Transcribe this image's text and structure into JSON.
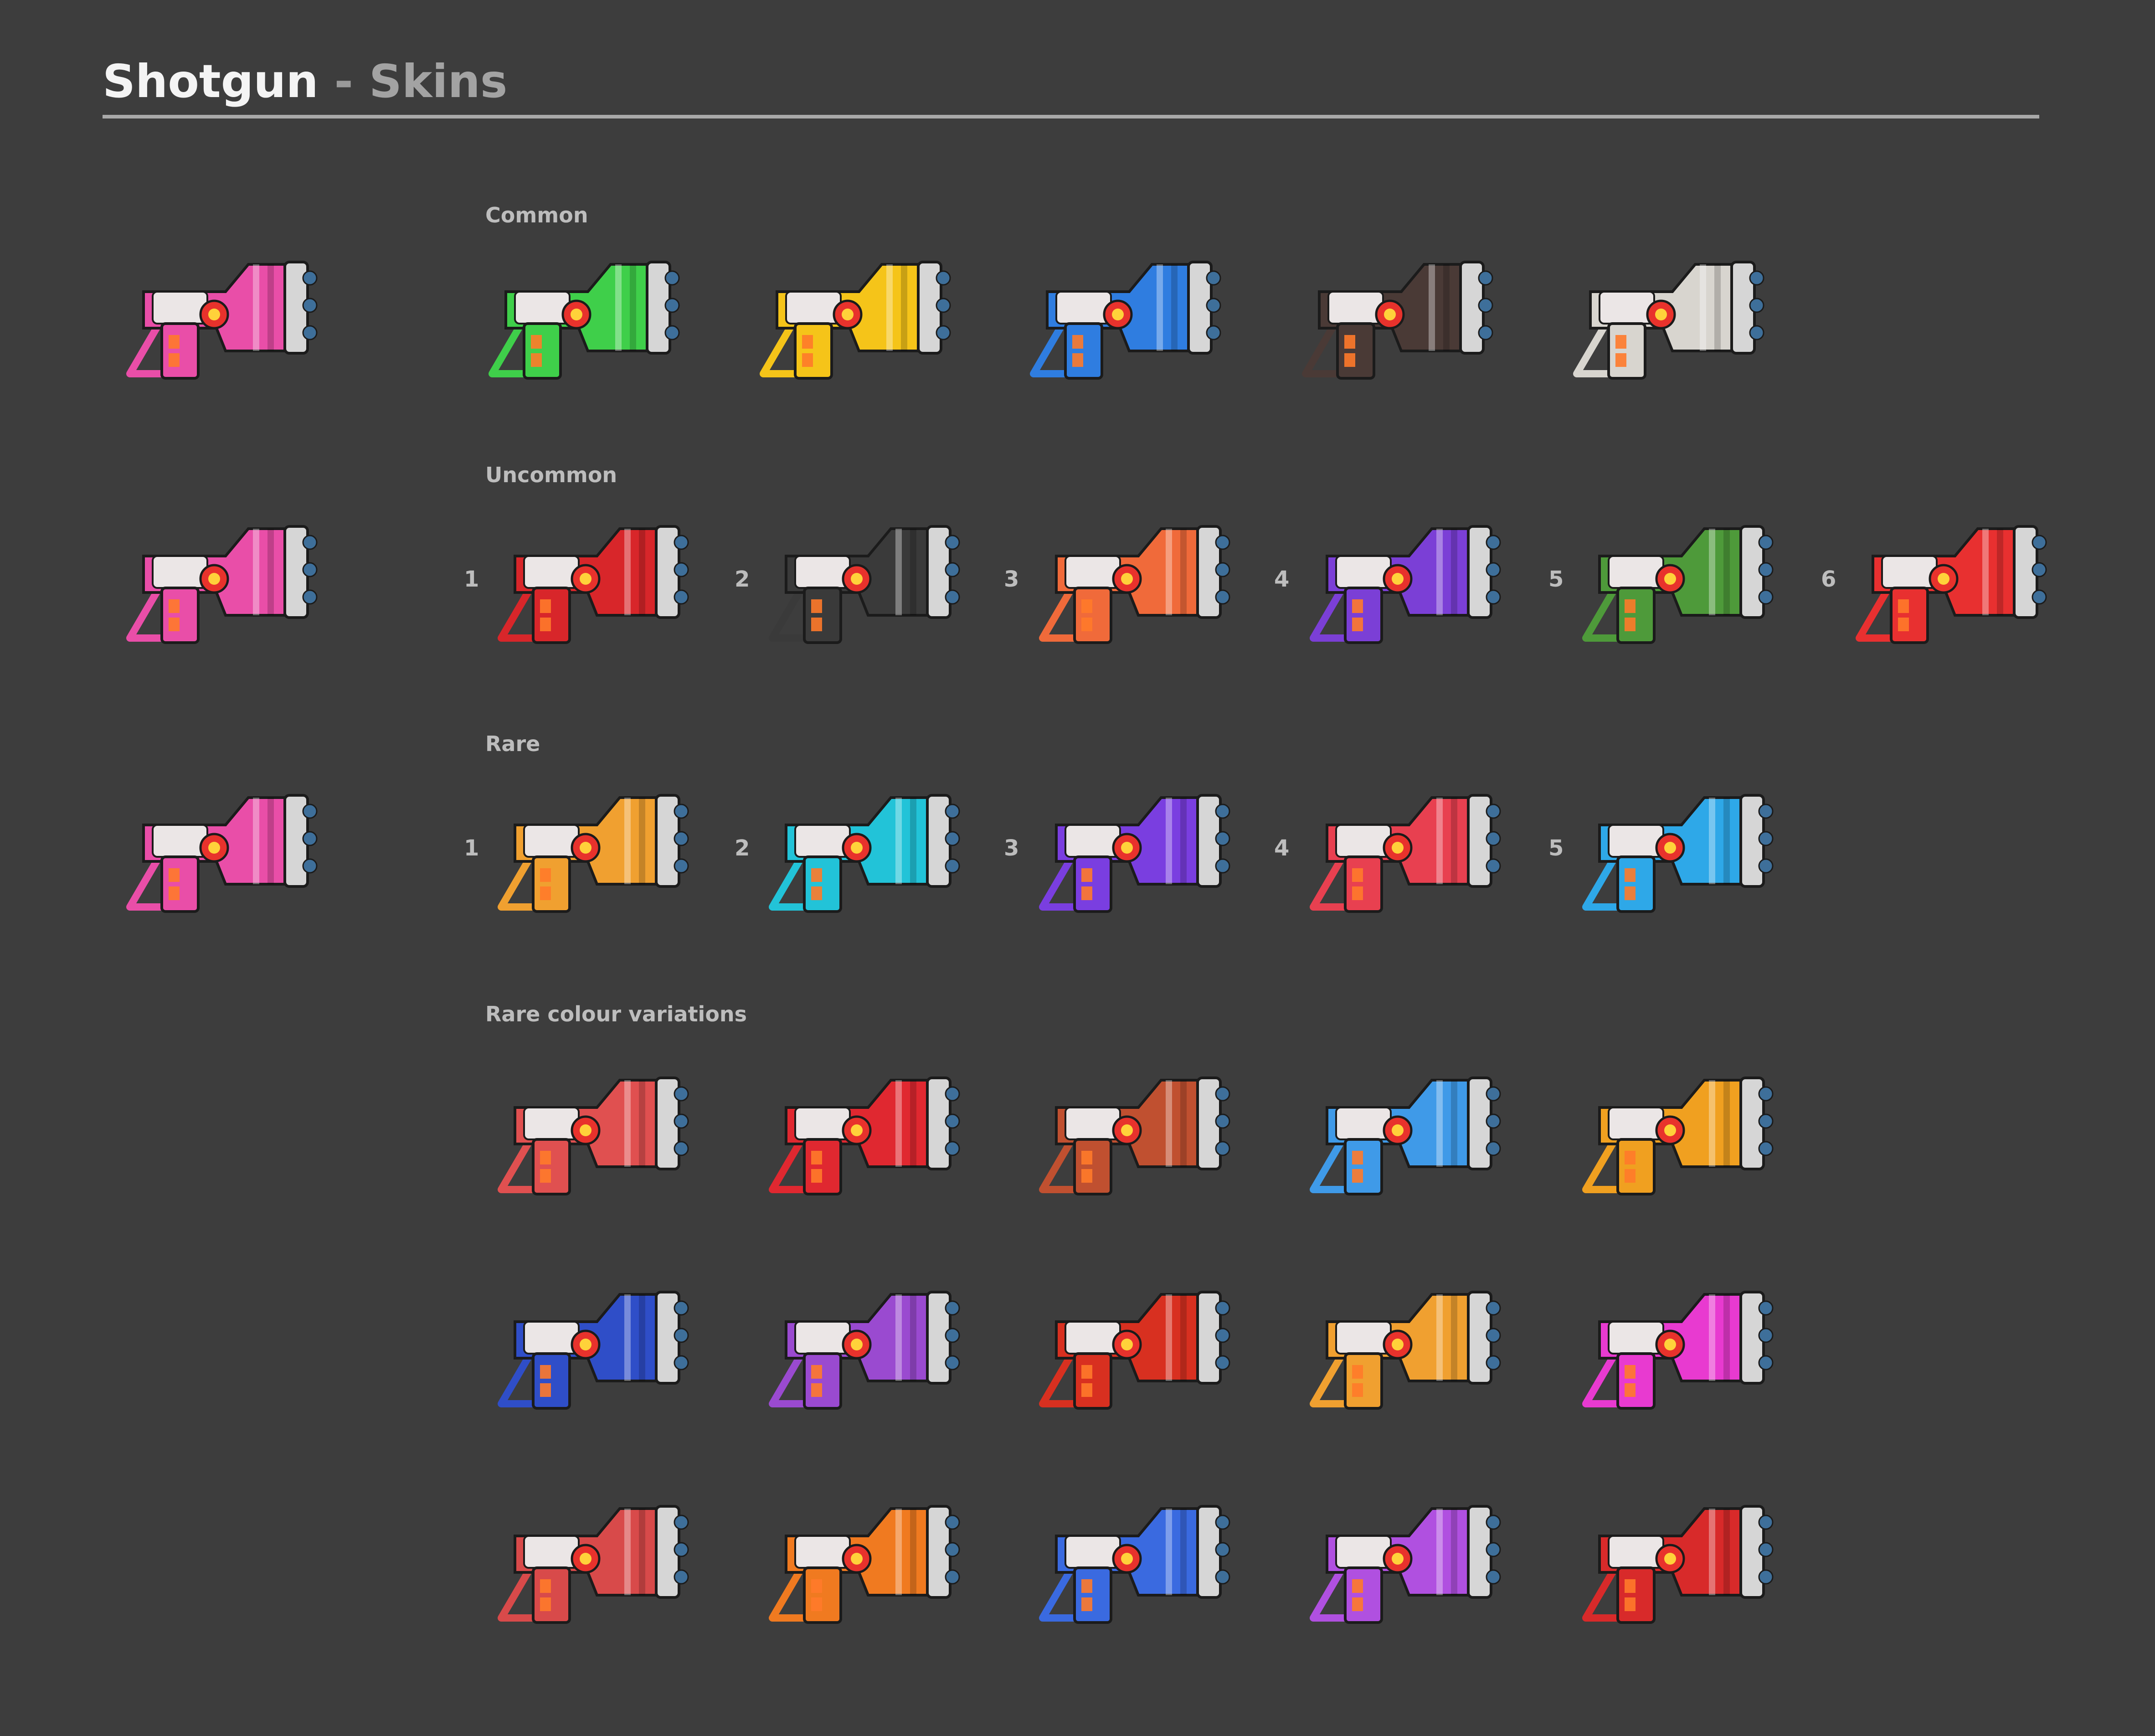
{
  "title": {
    "main": "Shotgun",
    "separator": "-",
    "sub": "Skins"
  },
  "sections": {
    "common": "Common",
    "uncommon": "Uncommon",
    "rare": "Rare",
    "rare_variations": "Rare colour variations"
  },
  "uncommon_numbers": [
    "1",
    "2",
    "3",
    "4",
    "5",
    "6"
  ],
  "rare_numbers": [
    "1",
    "2",
    "3",
    "4",
    "5"
  ],
  "icon": "shotgun-skin-icon",
  "colors": {
    "background": "#3d3d3d",
    "base_skin": "#e94ea8",
    "common": [
      "#3fcf4a",
      "#f5c419",
      "#2f7de0",
      "#4a3a36",
      "#d8d5cf"
    ],
    "uncommon": [
      "#d8262a",
      "#3a3a3a",
      "#f06a3a",
      "#7b3fd6",
      "#4e9a3a",
      "#e83030"
    ],
    "rare": [
      "#f0a030",
      "#22c3d8",
      "#7a3ee0",
      "#e84050",
      "#2ea8e8"
    ],
    "rare_variations_row1": [
      "#e05050",
      "#e02830",
      "#c05030",
      "#3f9ae8",
      "#f0a020"
    ],
    "rare_variations_row2": [
      "#2f4ec8",
      "#9a4ad0",
      "#d83020",
      "#f0a030",
      "#e83ad0"
    ],
    "rare_variations_row3": [
      "#d84a4a",
      "#f07a20",
      "#3a6ae0",
      "#b050e0",
      "#d82a2a"
    ]
  }
}
